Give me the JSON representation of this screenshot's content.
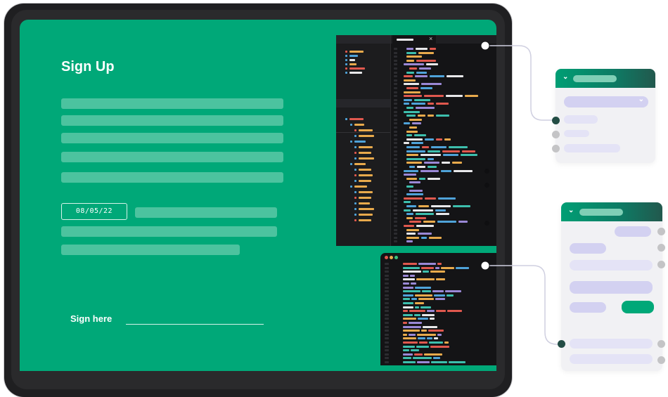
{
  "form": {
    "title": "Sign Up",
    "date_value": "08/05/22",
    "signature_label": "Sign here"
  },
  "editor": {
    "tab_close": "×"
  },
  "panels": {
    "chevron": "⌄"
  },
  "colors": {
    "brand_green": "#00a878",
    "placeholder_bar": "#4cc39f",
    "editor_bg": "#141416",
    "token_orange": "#e8aa4c",
    "token_purple": "#9a88d6",
    "token_blue": "#4fa3d9",
    "token_teal": "#3dbfad",
    "token_red": "#e0584e",
    "token_white": "#e8e8ea",
    "panel_pill": "#d3d1f1",
    "connector": "#cfcfe0",
    "dot_active": "#234d45"
  }
}
